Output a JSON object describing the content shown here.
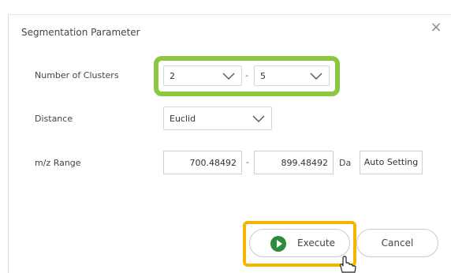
{
  "dialog": {
    "title": "Segmentation Parameter",
    "close_symbol": "×"
  },
  "clusters": {
    "label": "Number of Clusters",
    "min_value": "2",
    "separator": "-",
    "max_value": "5"
  },
  "distance": {
    "label": "Distance",
    "value": "Euclid"
  },
  "mz_range": {
    "label": "m/z Range",
    "min": "700.48492",
    "separator": "-",
    "max": "899.48492",
    "unit": "Da",
    "auto_setting": "Auto Setting"
  },
  "actions": {
    "execute": "Execute",
    "cancel": "Cancel"
  },
  "highlights": {
    "clusters_color": "#8cc63f",
    "execute_color": "#f5b400"
  },
  "icons": {
    "execute": "play-circle-icon",
    "pointer": "hand-pointer-icon",
    "dropdown": "chevron-down-icon"
  }
}
